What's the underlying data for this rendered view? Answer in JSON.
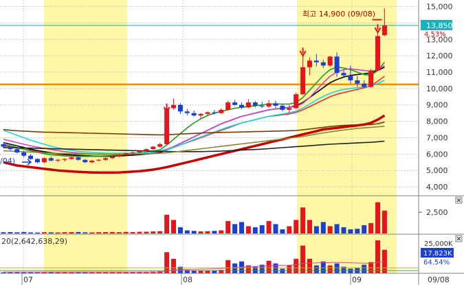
{
  "chart_data": [
    {
      "type": "candlestick",
      "title": "",
      "y_axis": {
        "min": 3500,
        "max": 15400,
        "ticks": [
          "15,000",
          "14,000",
          "13,000",
          "12,000",
          "11,000",
          "10,000",
          "9,000",
          "8,000",
          "7,000",
          "6,000",
          "5,000",
          "4,000"
        ]
      },
      "x_axis": {
        "month_labels": [
          "07",
          "08",
          "09",
          "09/08"
        ]
      },
      "highlight_periods": [
        "07 (first half)",
        "08/31 – 09/08"
      ],
      "annotations": {
        "high_label": "최고 14,900 (09/08)",
        "current_price": "13,850",
        "current_change_pct": "4.53%",
        "left_cut_label": "/04)"
      },
      "horizontal_lines": [
        {
          "value": 13850,
          "color": "#2ec4c4"
        },
        {
          "value": 10250,
          "color": "#f08c00"
        }
      ],
      "candles": [
        [
          6600,
          6650,
          6350,
          6450
        ],
        [
          6450,
          6500,
          6200,
          6300
        ],
        [
          6300,
          6400,
          6050,
          6100
        ],
        [
          6100,
          6200,
          5800,
          5900
        ],
        [
          5900,
          6000,
          5650,
          5700
        ],
        [
          5700,
          5750,
          5450,
          5500
        ],
        [
          5500,
          5800,
          5450,
          5750
        ],
        [
          5750,
          5850,
          5550,
          5600
        ],
        [
          5600,
          5700,
          5500,
          5650
        ],
        [
          5650,
          5750,
          5550,
          5700
        ],
        [
          5700,
          5850,
          5650,
          5800
        ],
        [
          5800,
          5900,
          5600,
          5650
        ],
        [
          5650,
          5700,
          5450,
          5500
        ],
        [
          5500,
          5650,
          5450,
          5600
        ],
        [
          5600,
          5700,
          5550,
          5650
        ],
        [
          5650,
          5800,
          5600,
          5750
        ],
        [
          5750,
          5900,
          5700,
          5850
        ],
        [
          5850,
          6000,
          5800,
          5950
        ],
        [
          5950,
          6100,
          5900,
          6050
        ],
        [
          6050,
          6150,
          6000,
          6100
        ],
        [
          6100,
          6250,
          6050,
          6200
        ],
        [
          6200,
          6350,
          6150,
          6300
        ],
        [
          6300,
          6500,
          6250,
          6450
        ],
        [
          6450,
          6700,
          6400,
          6600
        ],
        [
          6600,
          8900,
          6550,
          8800
        ],
        [
          8800,
          9400,
          8700,
          9000
        ],
        [
          9000,
          9100,
          8450,
          8600
        ],
        [
          8600,
          8750,
          8350,
          8500
        ],
        [
          8500,
          8650,
          8300,
          8350
        ],
        [
          8350,
          8500,
          8150,
          8450
        ],
        [
          8450,
          8600,
          8350,
          8550
        ],
        [
          8550,
          8700,
          8400,
          8500
        ],
        [
          8500,
          8800,
          8450,
          8700
        ],
        [
          8700,
          9250,
          8650,
          9150
        ],
        [
          9150,
          9300,
          8950,
          9000
        ],
        [
          9000,
          9150,
          8750,
          8850
        ],
        [
          8850,
          9350,
          8800,
          9150
        ],
        [
          9150,
          9250,
          8850,
          8950
        ],
        [
          8950,
          9200,
          8800,
          8900
        ],
        [
          8900,
          9300,
          8800,
          9100
        ],
        [
          9100,
          9250,
          8800,
          8950
        ],
        [
          8950,
          9050,
          8600,
          8700
        ],
        [
          8700,
          9000,
          8500,
          8800
        ],
        [
          8800,
          9750,
          8750,
          9650
        ],
        [
          9650,
          12000,
          9600,
          11300
        ],
        [
          11300,
          11900,
          10800,
          11700
        ],
        [
          11700,
          12100,
          11350,
          11600
        ],
        [
          11600,
          11750,
          11250,
          11400
        ],
        [
          11400,
          12000,
          11300,
          11950
        ],
        [
          11950,
          12200,
          10700,
          10950
        ],
        [
          10950,
          11150,
          10700,
          10800
        ],
        [
          10800,
          11400,
          10300,
          10500
        ],
        [
          10500,
          10750,
          10100,
          10300
        ],
        [
          10300,
          10500,
          10000,
          10100
        ],
        [
          10100,
          11200,
          10050,
          11100
        ],
        [
          11100,
          13500,
          11050,
          13200
        ],
        [
          13250,
          14900,
          13200,
          13850
        ]
      ],
      "moving_averages": [
        {
          "color": "#ff2b2b",
          "values": [
            6500,
            6450,
            6380,
            6300,
            6230,
            6160,
            6100,
            6050,
            6000,
            5960,
            5930,
            5900,
            5880,
            5870,
            5860,
            5860,
            5870,
            5880,
            5900,
            5930,
            5960,
            6000,
            6050,
            6110,
            6250,
            6400,
            6550,
            6700,
            6850,
            7000,
            7150,
            7300,
            7450,
            7600,
            7750,
            7900,
            8000,
            8100,
            8200,
            8300,
            8350,
            8400,
            8450,
            8550,
            8700,
            8900,
            9100,
            9300,
            9500,
            9650,
            9750,
            9850,
            9950,
            10050,
            10150,
            10450,
            10750
          ]
        },
        {
          "color": "#000000",
          "values": [
            6700,
            6600,
            6500,
            6400,
            6300,
            6220,
            6150,
            6080,
            6020,
            5980,
            5950,
            5920,
            5900,
            5880,
            5870,
            5870,
            5880,
            5890,
            5910,
            5940,
            5970,
            6000,
            6040,
            6090,
            6250,
            6450,
            6650,
            6850,
            7050,
            7250,
            7450,
            7650,
            7850,
            8000,
            8150,
            8300,
            8400,
            8500,
            8600,
            8700,
            8750,
            8800,
            8850,
            8950,
            9150,
            9450,
            9750,
            10050,
            10350,
            10550,
            10700,
            10800,
            10850,
            10900,
            10950,
            11100,
            11300
          ]
        },
        {
          "color": "#1a9e1a",
          "values": [
            6600,
            6500,
            6400,
            6300,
            6200,
            6100,
            6020,
            5960,
            5920,
            5890,
            5870,
            5860,
            5860,
            5860,
            5870,
            5890,
            5910,
            5940,
            5980,
            6020,
            6070,
            6120,
            6180,
            6260,
            6550,
            6900,
            7250,
            7600,
            7900,
            8150,
            8350,
            8500,
            8600,
            8700,
            8800,
            8850,
            8900,
            8950,
            9000,
            9050,
            9050,
            9050,
            9050,
            9150,
            9450,
            9900,
            10350,
            10800,
            11150,
            11300,
            11250,
            11150,
            11000,
            10850,
            10800,
            11100,
            11600
          ]
        },
        {
          "color": "#cc44cc",
          "values": [
            6900,
            6800,
            6700,
            6600,
            6500,
            6420,
            6350,
            6280,
            6210,
            6150,
            6100,
            6060,
            6030,
            6010,
            6000,
            5990,
            5990,
            6000,
            6010,
            6030,
            6060,
            6090,
            6130,
            6180,
            6300,
            6450,
            6650,
            6850,
            7050,
            7250,
            7450,
            7650,
            7850,
            8000,
            8150,
            8300,
            8400,
            8500,
            8600,
            8700,
            8750,
            8800,
            8850,
            8900,
            9100,
            9450,
            9900,
            10350,
            10750,
            11000,
            11150,
            11200,
            11150,
            11100,
            11050,
            11150,
            11400
          ]
        },
        {
          "color": "#17d6e6",
          "values": [
            7450,
            7300,
            7150,
            7000,
            6850,
            6720,
            6600,
            6480,
            6380,
            6300,
            6230,
            6170,
            6130,
            6100,
            6080,
            6060,
            6050,
            6050,
            6050,
            6060,
            6070,
            6090,
            6120,
            6160,
            6260,
            6400,
            6560,
            6720,
            6880,
            7040,
            7200,
            7350,
            7500,
            7650,
            7780,
            7900,
            8000,
            8100,
            8200,
            8300,
            8380,
            8450,
            8520,
            8620,
            8800,
            9050,
            9300,
            9520,
            9700,
            9850,
            9950,
            10000,
            10050,
            10100,
            10150,
            10300,
            10500
          ]
        },
        {
          "color": "#7a3b00",
          "values": [
            7500,
            7450,
            7420,
            7400,
            7380,
            7360,
            7340,
            7330,
            7320,
            7310,
            7300,
            7290,
            7280,
            7270,
            7260,
            7250,
            7240,
            7230,
            7220,
            7210,
            7200,
            7190,
            7180,
            7170,
            7180,
            7200,
            7220,
            7240,
            7260,
            7280,
            7300,
            7310,
            7320,
            7330,
            7340,
            7350,
            7360,
            7370,
            7380,
            7390,
            7400,
            7410,
            7420,
            7440,
            7480,
            7530,
            7580,
            7630,
            7680,
            7720,
            7750,
            7770,
            7780,
            7790,
            7800,
            7850,
            7950
          ]
        },
        {
          "color": "#c40000",
          "values": [
            5500,
            5400,
            5300,
            5250,
            5200,
            5150,
            5100,
            5050,
            5000,
            4970,
            4940,
            4910,
            4890,
            4880,
            4870,
            4870,
            4870,
            4880,
            4900,
            4930,
            4960,
            5000,
            5050,
            5120,
            5200,
            5300,
            5400,
            5500,
            5600,
            5700,
            5800,
            5900,
            6000,
            6100,
            6200,
            6300,
            6400,
            6500,
            6600,
            6700,
            6800,
            6900,
            7000,
            7100,
            7200,
            7300,
            7400,
            7500,
            7550,
            7600,
            7650,
            7700,
            7750,
            7800,
            7900,
            8100,
            8350
          ]
        },
        {
          "color": "#222222",
          "values": [
            6400,
            6390,
            6380,
            6370,
            6360,
            6350,
            6340,
            6330,
            6320,
            6310,
            6300,
            6290,
            6280,
            6270,
            6260,
            6250,
            6240,
            6230,
            6220,
            6210,
            6200,
            6190,
            6180,
            6170,
            6160,
            6150,
            6150,
            6150,
            6150,
            6150,
            6160,
            6170,
            6180,
            6200,
            6220,
            6240,
            6260,
            6280,
            6300,
            6330,
            6360,
            6390,
            6420,
            6450,
            6480,
            6510,
            6540,
            6570,
            6600,
            6620,
            6640,
            6660,
            6680,
            6700,
            6720,
            6750,
            6790
          ]
        },
        {
          "color": "#888833",
          "values": [
            6200,
            6180,
            6160,
            6140,
            6120,
            6100,
            6080,
            6060,
            6040,
            6030,
            6020,
            6010,
            6000,
            5990,
            5985,
            5980,
            5980,
            5985,
            5990,
            6000,
            6010,
            6020,
            6035,
            6050,
            6080,
            6120,
            6170,
            6220,
            6270,
            6320,
            6370,
            6420,
            6470,
            6520,
            6570,
            6620,
            6670,
            6720,
            6770,
            6820,
            6870,
            6920,
            6970,
            7020,
            7080,
            7150,
            7220,
            7290,
            7350,
            7410,
            7470,
            7520,
            7570,
            7600,
            7630,
            7660,
            7700
          ]
        }
      ],
      "volume": {
        "label_ticks": [
          "2,500"
        ],
        "values": [
          120,
          130,
          110,
          140,
          100,
          90,
          120,
          110,
          100,
          120,
          130,
          140,
          110,
          100,
          120,
          130,
          140,
          120,
          150,
          130,
          160,
          170,
          200,
          220,
          1800,
          1300,
          600,
          300,
          250,
          200,
          220,
          250,
          300,
          1200,
          900,
          1100,
          700,
          600,
          800,
          1200,
          900,
          400,
          700,
          1300,
          2500,
          1300,
          700,
          1100,
          700,
          900,
          600,
          400,
          450,
          800,
          1000,
          3000,
          2200
        ],
        "max": 3300
      },
      "lower_indicator": {
        "label": "20(2,642,638,29)",
        "tick": "25,000K",
        "current_value": "17,823K",
        "current_pct": "64.54%",
        "values": [
          800,
          900,
          850,
          900,
          800,
          700,
          900,
          800,
          750,
          850,
          900,
          950,
          800,
          750,
          850,
          900,
          950,
          850,
          1000,
          950,
          1100,
          1200,
          1400,
          1600,
          16000,
          11000,
          5000,
          2500,
          2000,
          1800,
          2000,
          2200,
          2600,
          10000,
          7500,
          9000,
          6000,
          5000,
          6500,
          9500,
          7500,
          3500,
          6000,
          11000,
          21000,
          11000,
          6000,
          9000,
          6000,
          7500,
          5000,
          3500,
          4000,
          6500,
          8500,
          25000,
          17823
        ],
        "line_values": [
          1000,
          1000,
          1000,
          1000,
          1000,
          1000,
          1000,
          1000,
          1000,
          1000,
          1000,
          1000,
          1000,
          1000,
          1000,
          1000,
          1000,
          1000,
          1000,
          1000,
          1000,
          1000,
          1000,
          1000,
          2000,
          2600,
          2800,
          2900,
          3000,
          3100,
          3200,
          3400,
          3600,
          4000,
          4300,
          4700,
          5000,
          5200,
          5400,
          5700,
          6000,
          6100,
          6200,
          6600,
          7400,
          7700,
          7900,
          8100,
          8200,
          8300,
          8200,
          8000,
          7800,
          7700,
          7600,
          8400,
          8900
        ],
        "max": 26000
      }
    }
  ]
}
